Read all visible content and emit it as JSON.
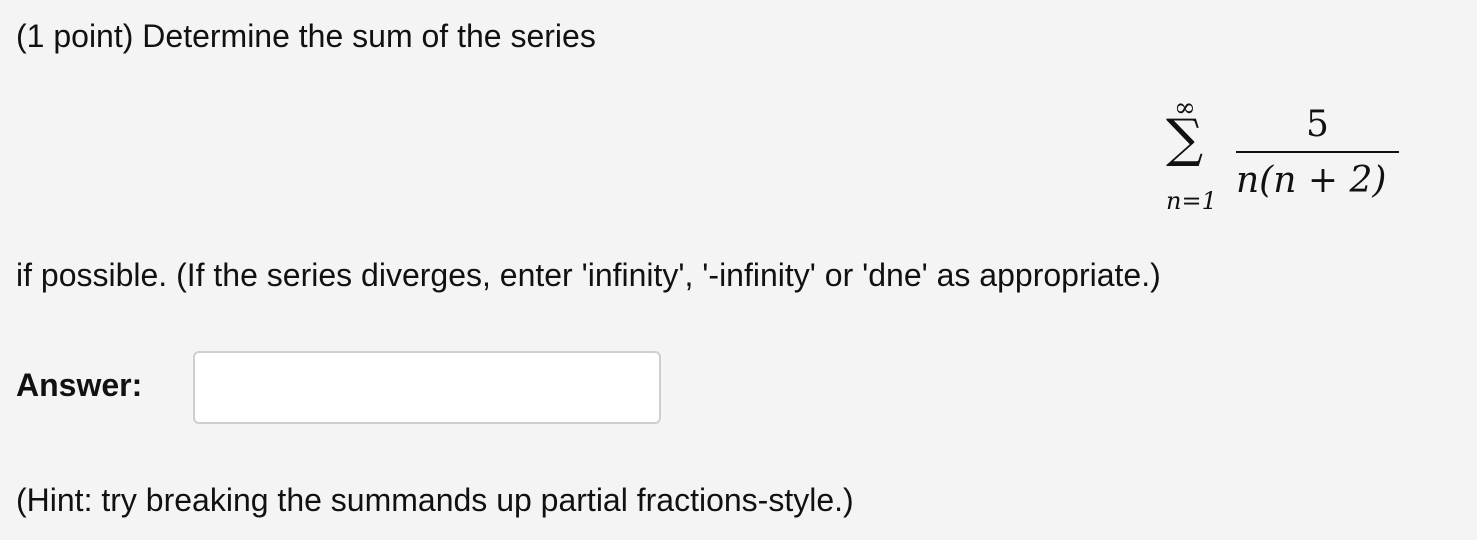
{
  "problem": {
    "intro": "(1 point) Determine the sum of the series",
    "condition": "if possible. (If the series diverges, enter 'infinity', '-infinity' or 'dne' as appropriate.)",
    "hint": "(Hint: try breaking the summands up partial fractions-style.)"
  },
  "formula": {
    "sum_symbol": "∑",
    "upper_limit": "∞",
    "lower_limit": "n=1",
    "numerator": "5",
    "denominator": "n(n + 2)"
  },
  "answer": {
    "label": "Answer:",
    "value": "",
    "placeholder": ""
  }
}
